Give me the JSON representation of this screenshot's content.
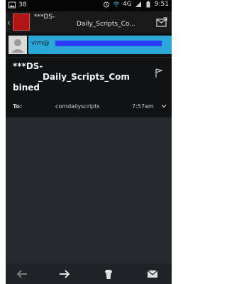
{
  "status_bar": {
    "left_icon_1": "image-icon",
    "left_badge": "38",
    "right_network": "4G",
    "time": "9:51"
  },
  "action_bar": {
    "title_line_1": "***DS-",
    "title_right": "Daily_Scripts_Co...",
    "compose_icon": "compose-icon"
  },
  "sender": {
    "label": "vim@"
  },
  "email": {
    "subject_line_1": "***DS-",
    "subject_line_2": "_Daily_Scripts_Com",
    "subject_line_3": "bined",
    "to_label": "To:",
    "to_value": "comdailyscripts",
    "time": "7:57am"
  },
  "bottom_actions": {
    "prev": "arrow-left-icon",
    "next": "arrow-right-icon",
    "delete": "trash-icon",
    "mail": "mail-icon"
  },
  "colors": {
    "accent_blue": "#2aa7d6"
  }
}
